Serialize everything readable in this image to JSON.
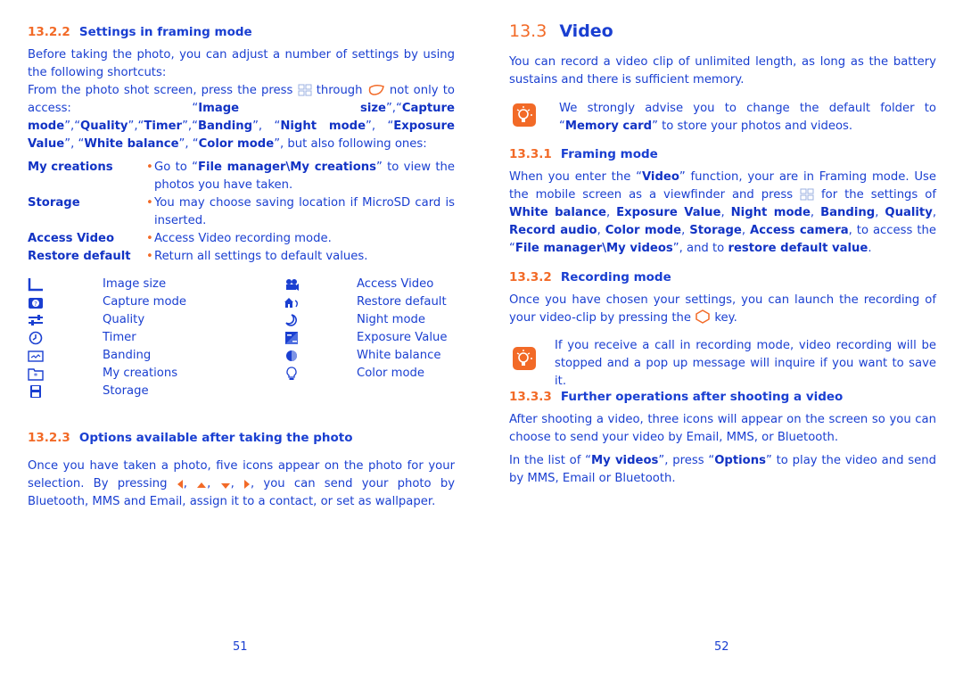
{
  "left_page": {
    "section_2_2": {
      "number": "13.2.2",
      "title": "Settings in framing mode",
      "intro_1": "Before taking the photo, you can adjust a number of settings by using the following shortcuts:",
      "intro_2_pre": "From the photo shot screen, press the press",
      "intro_2_mid": "through",
      "intro_2_post": "not only to access:",
      "options": [
        "Image size",
        "Capture mode",
        "Quality",
        "Timer",
        "Banding",
        "Night mode",
        "Exposure Value",
        "White balance",
        "Color mode"
      ],
      "intro_end": "but also following ones:",
      "definitions": [
        {
          "term": "My creations",
          "desc_pre": "Go to “",
          "desc_bold": "File manager\\My creations",
          "desc_post": "” to view the photos you have taken."
        },
        {
          "term": "Storage",
          "desc_pre": "You may choose saving location if MicroSD card is inserted.",
          "desc_bold": "",
          "desc_post": ""
        },
        {
          "term": "Access Video",
          "desc_pre": "Access Video recording mode.",
          "desc_bold": "",
          "desc_post": ""
        },
        {
          "term": "Restore default",
          "desc_pre": "Return all settings to default values.",
          "desc_bold": "",
          "desc_post": ""
        }
      ],
      "bullet": "•",
      "icon_list_left": [
        {
          "icon": "image-size-icon",
          "label": "Image size"
        },
        {
          "icon": "capture-mode-icon",
          "label": "Capture mode"
        },
        {
          "icon": "quality-icon",
          "label": "Quality"
        },
        {
          "icon": "timer-icon",
          "label": "Timer"
        },
        {
          "icon": "banding-icon",
          "label": "Banding"
        },
        {
          "icon": "my-creations-icon",
          "label": "My creations"
        },
        {
          "icon": "storage-icon",
          "label": "Storage"
        }
      ],
      "icon_list_right": [
        {
          "icon": "access-video-icon",
          "label": "Access Video"
        },
        {
          "icon": "restore-default-icon",
          "label": "Restore default"
        },
        {
          "icon": "night-mode-icon",
          "label": "Night mode"
        },
        {
          "icon": "exposure-value-icon",
          "label": "Exposure Value"
        },
        {
          "icon": "white-balance-icon",
          "label": "White balance"
        },
        {
          "icon": "color-mode-icon",
          "label": "Color mode"
        }
      ]
    },
    "section_2_3": {
      "number": "13.2.3",
      "title": "Options available after taking the photo",
      "body_pre": "Once you have taken a photo, five icons appear on the photo for your selection. By pressing",
      "body_post": ", you can send your photo by Bluetooth, MMS and Email, assign it to a contact, or set as wallpaper."
    },
    "page_number": "51"
  },
  "right_page": {
    "section_3": {
      "number": "13.3",
      "title": "Video",
      "intro": "You can record a video clip of unlimited length, as long as the battery sustains and there is sufficient memory.",
      "tip_pre": "We strongly advise you to change the default folder to “",
      "tip_bold": "Memory card",
      "tip_post": "” to store your photos and videos."
    },
    "section_3_1": {
      "number": "13.3.1",
      "title": "Framing mode",
      "t1": "When you enter the “",
      "b1": "Video",
      "t2": "” function, your are in Framing mode. Use the mobile screen as a viewfinder and press",
      "t3": "for the settings of",
      "b_list": [
        "White balance",
        "Exposure Value",
        "Night mode",
        "Banding",
        "Quality",
        "Record audio",
        "Color mode",
        "Storage",
        "Access camera"
      ],
      "t4": ", to access the “",
      "b2": "File manager\\My videos",
      "t5": "”, and to",
      "b3": "restore default value",
      "t6": "."
    },
    "section_3_2": {
      "number": "13.3.2",
      "title": "Recording mode",
      "body_pre": "Once you have chosen your settings, you can launch the recording of your video-clip by pressing the",
      "body_post": "key.",
      "tip": "If you receive a call in recording mode, video recording will be stopped and a pop up message will inquire if you want to save it."
    },
    "section_3_3": {
      "number": "13.3.3",
      "title": "Further operations after shooting a video",
      "body_1": "After shooting a video, three icons will appear on the screen so you can choose to send your video by Email, MMS, or Bluetooth.",
      "body_2_pre": "In the list of “",
      "body_2_b1": "My videos",
      "body_2_mid": "”, press “",
      "body_2_b2": "Options",
      "body_2_post": "” to play the video and send by MMS, Email or Bluetooth."
    },
    "page_number": "52"
  },
  "colors": {
    "text_blue": "#1a3fd1",
    "accent_orange": "#f26a27"
  }
}
